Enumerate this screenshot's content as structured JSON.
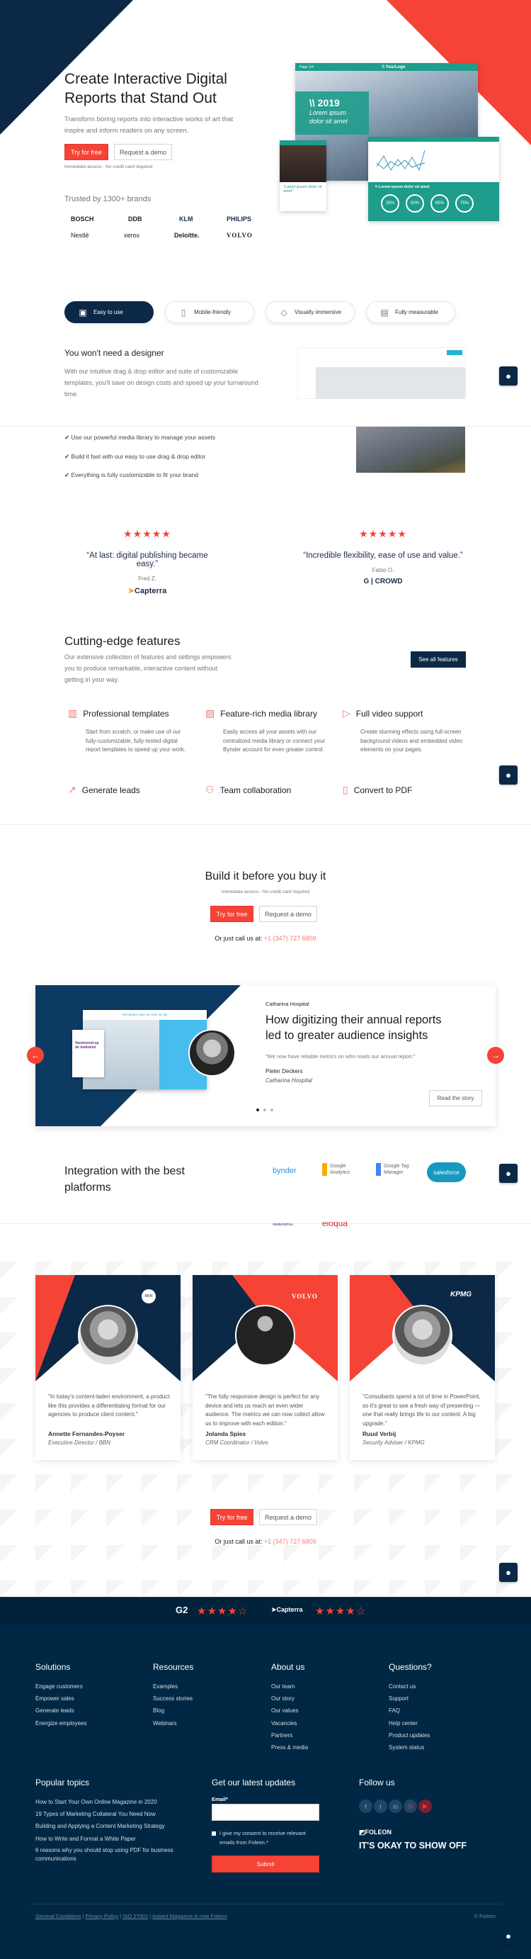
{
  "colors": {
    "navy": "#0c2847",
    "red": "#f54336",
    "teal": "#1e9c8c",
    "footer": "#002844"
  },
  "hero": {
    "title_line1": "Create Interactive Digital",
    "title_line2": "Reports that Stand Out",
    "subtitle_line1": "Transform boring reports into interactive works of art that",
    "subtitle_line2": "inspire and inform readers on any screen.",
    "try_label": "Try for free",
    "demo_label": "Request a demo",
    "note": "Immediate access - No credit card required",
    "trusted": "Trusted by 1300+ brands",
    "brands": [
      "BOSCH",
      "DDB",
      "KLM",
      "PHILIPS",
      "Nestlé",
      "xerox",
      "Deloitte.",
      "VOLVO"
    ],
    "mockup": {
      "logo": "\\\\ YourLogo",
      "page": "Page 1/4",
      "year": "\\\\ 2019",
      "headline_line1": "Lorem ipsum",
      "headline_line2": "dolor sit amet",
      "quote": "\"Lorem ipsum dolor sit amet\"",
      "banner": "\\\\ Lorem ipsum dolor sit amet",
      "stats": [
        "25%",
        "50%",
        "65%",
        "75%"
      ]
    }
  },
  "tabs": [
    {
      "label": "Easy to use",
      "icon": "template-icon",
      "active": true
    },
    {
      "label": "Mobile-friendly",
      "icon": "mobile-icon",
      "active": false
    },
    {
      "label": "Visually immersive",
      "icon": "diamond-icon",
      "active": false
    },
    {
      "label": "Fully measurable",
      "icon": "analytics-icon",
      "active": false
    }
  ],
  "designer": {
    "heading": "You won't need a designer",
    "text_line1": "With our intuitive drag & drop editor and suite of customizable",
    "text_line2": "templates, you'll save on design costs and speed up your turnaround",
    "text_line3": "time.",
    "checks": [
      "Use our powerful media library to manage your assets",
      "Build it fast with our easy to use drag & drop editor",
      "Everything is fully customizable to fit your brand"
    ]
  },
  "reviews": [
    {
      "stars": 5,
      "quote": "“At last: digital publishing became easy.”",
      "name": "Fred Z.",
      "source": "Capterra"
    },
    {
      "stars": 5,
      "quote": "“Incredible flexibility, ease of use and value.”",
      "name": "Fabio O.",
      "source": "CROWD"
    }
  ],
  "features": {
    "heading": "Cutting-edge features",
    "text_line1": "Our extensive collection of features and settings empowers",
    "text_line2": "you to produce remarkable, interactive content without",
    "text_line3": "getting in your way.",
    "button": "See all features",
    "items": [
      {
        "title": "Professional templates",
        "icon": "templates-icon",
        "desc": "Start from scratch, or make use of our fully-customizable, fully-tested digital report templates to speed up your work."
      },
      {
        "title": "Feature-rich media library",
        "icon": "media-library-icon",
        "desc": "Easily access all your assets with our centralized media library or connect your Bynder account for even greater control."
      },
      {
        "title": "Full video support",
        "icon": "video-icon",
        "desc": "Create stunning effects using full-screen background videos and embedded video elements on your pages."
      },
      {
        "title": "Generate leads",
        "icon": "chart-growth-icon",
        "desc": ""
      },
      {
        "title": "Team collaboration",
        "icon": "team-icon",
        "desc": ""
      },
      {
        "title": "Convert to PDF",
        "icon": "pdf-icon",
        "desc": ""
      }
    ]
  },
  "build": {
    "heading": "Build it before you buy it",
    "note": "Immediate access - No credit card required",
    "try_label": "Try for free",
    "demo_label": "Request a demo",
    "call_label": "Or just call us at:",
    "phone": "+1 (347) 727 6809"
  },
  "case": {
    "company": "Catharina Hospital",
    "headline_line1": "How digitizing their annual reports",
    "headline_line2": "led to greater audience insights",
    "quote": "\"We now have reliable metrics on who reads our annual report.\"",
    "person": "Pieter Deckers",
    "role": "Catharina Hospital",
    "button": "Read the story",
    "mock_title": "Resultaten waar we trots op zijn",
    "mock_heading": "Voorbereid op de toekomst",
    "slide_count": 3,
    "active_slide": 1
  },
  "integration": {
    "heading_line1": "Integration with the best",
    "heading_line2": "platforms",
    "logos": [
      "bynder",
      "Google Analytics",
      "Google Tag Manager",
      "salesforce",
      "Marketo",
      "eloqua"
    ]
  },
  "testimonials": [
    {
      "logo": "BBN",
      "quote": "\"In today's content-laden environment, a product like this provides a differentiating format for our agencies to produce client content.\"",
      "name": "Annette Fernandes-Poyser",
      "role": "Executive Director / BBN"
    },
    {
      "logo": "VOLVO",
      "quote": "\"The fully responsive design is perfect for any device and lets us reach an even wider audience. The metrics we can now collect allow us to improve with each edition.\"",
      "name": "Jolanda Spies",
      "role": "CRM Coordinator / Volvo"
    },
    {
      "logo": "KPMG",
      "quote": "\"Consultants spend a lot of time in PowerPoint, so it's great to see a fresh way of presenting — one that really brings life to our content. A big upgrade.\"",
      "name": "Ruud Verbij",
      "role": "Security Adviser / KPMG"
    }
  ],
  "cta": {
    "try_label": "Try for free",
    "demo_label": "Request a demo",
    "call_label": "Or just call us at:",
    "phone": "+1 (347) 727 6809"
  },
  "ratings": [
    {
      "source": "G2",
      "stars": 4.5
    },
    {
      "source": "Capterra",
      "stars": 4.5
    }
  ],
  "footer": {
    "columns": [
      {
        "title": "Solutions",
        "links": [
          "Engage customers",
          "Empower sales",
          "Generate leads",
          "Energize employees"
        ]
      },
      {
        "title": "Resources",
        "links": [
          "Examples",
          "Success stories",
          "Blog",
          "Webinars"
        ]
      },
      {
        "title": "About us",
        "links": [
          "Our team",
          "Our story",
          "Our values",
          "Vacancies",
          "Partners",
          "Press & media"
        ]
      },
      {
        "title": "Questions?",
        "links": [
          "Contact us",
          "Support",
          "FAQ",
          "Help center",
          "Product updates",
          "System status"
        ]
      }
    ],
    "topics_title": "Popular topics",
    "topics": [
      "How to Start Your Own Online Magazine in 2020",
      "19 Types of Marketing Collateral You Need Now",
      "Building and Applying a Content Marketing Strategy",
      "How to Write and Format a White Paper",
      "6 reasons why you should stop using PDF for business communications"
    ],
    "updates_title": "Get our latest updates",
    "email_label": "Email*",
    "email_value": "",
    "consent": "I give my consent to receive relevant emails from Foleon.*",
    "submit": "Submit",
    "follow_title": "Follow us",
    "social": [
      "facebook",
      "twitter",
      "linkedin",
      "instagram",
      "youtube"
    ],
    "brand": "FOLEON",
    "slogan": "IT'S OKAY TO SHOW OFF",
    "legal": [
      "General Conditions",
      "Privacy Policy",
      "ISO 27001",
      "Instant Magazine is now Foleon"
    ],
    "copyright": "© Foleon"
  }
}
